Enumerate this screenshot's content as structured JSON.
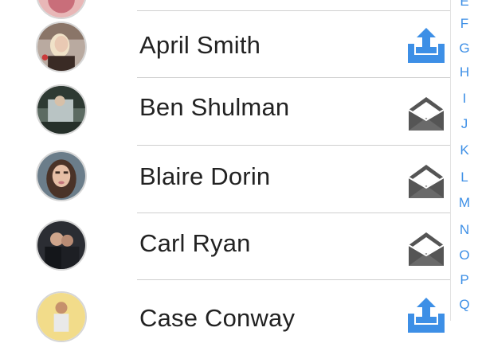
{
  "contacts": [
    {
      "name": "April Smith",
      "action_icon": "upload-tray-icon",
      "avatar": "avatar-photo"
    },
    {
      "name": "Ben Shulman",
      "action_icon": "open-envelope-icon",
      "avatar": "avatar-photo"
    },
    {
      "name": "Blaire Dorin",
      "action_icon": "open-envelope-icon",
      "avatar": "avatar-photo"
    },
    {
      "name": "Carl Ryan",
      "action_icon": "open-envelope-icon",
      "avatar": "avatar-photo"
    },
    {
      "name": "Case Conway",
      "action_icon": "upload-tray-icon",
      "avatar": "avatar-photo"
    }
  ],
  "index_letters": [
    "E",
    "F",
    "G",
    "H",
    "I",
    "J",
    "K",
    "L",
    "M",
    "N",
    "O",
    "P",
    "Q"
  ],
  "colors": {
    "accent": "#3d8fe6",
    "icon_gray": "#555555",
    "text": "#222222",
    "divider": "#cfcfcf"
  }
}
